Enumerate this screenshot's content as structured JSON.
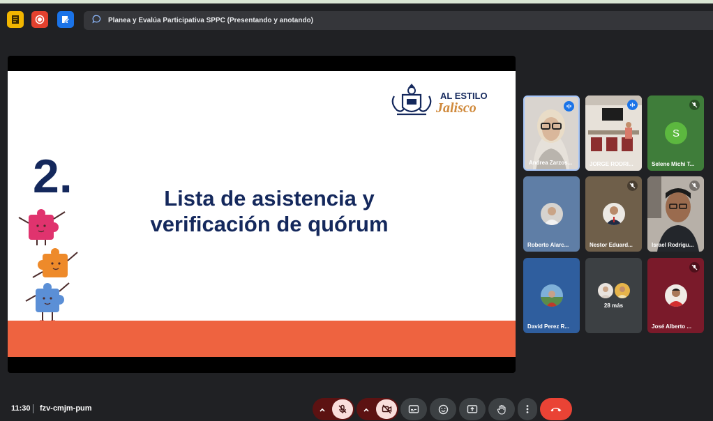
{
  "title_bar": {
    "text": "Planea y Evalúa Participativa SPPC (Presentando y anotando)",
    "icon_colors": [
      "#f2b600",
      "#e3412e",
      "#1a73e8"
    ]
  },
  "slide": {
    "number": "2.",
    "heading_line1": "Lista de asistencia y",
    "heading_line2": "verificación de quórum",
    "logo_line1": "AL ESTILO",
    "logo_line2": "Jalisco",
    "band_color": "#ee6340",
    "text_color": "#14285c"
  },
  "participants": [
    {
      "name": "Andrea Zarzos...",
      "status": "speaking"
    },
    {
      "name": "JORGE RODRI...",
      "status": "speaking"
    },
    {
      "name": "Selene Michi T...",
      "status": "muted",
      "initial": "S"
    },
    {
      "name": "Roberto Alarc...",
      "status": "none"
    },
    {
      "name": "Nestor Eduard...",
      "status": "muted"
    },
    {
      "name": "Israel Rodrigu...",
      "status": "muted"
    },
    {
      "name": "David Perez R...",
      "status": "none"
    },
    {
      "name": "28 más",
      "status": "none"
    },
    {
      "name": "José Alberto ...",
      "status": "muted"
    }
  ],
  "bottom_bar": {
    "time": "11:30",
    "meeting_code": "fzv-cmjm-pum",
    "icons": [
      "chevron-up-icon",
      "mic-off-icon",
      "chevron-up-icon",
      "camera-off-icon",
      "captions-icon",
      "emoji-icon",
      "present-icon",
      "raise-hand-icon",
      "more-options-icon",
      "end-call-icon"
    ]
  }
}
